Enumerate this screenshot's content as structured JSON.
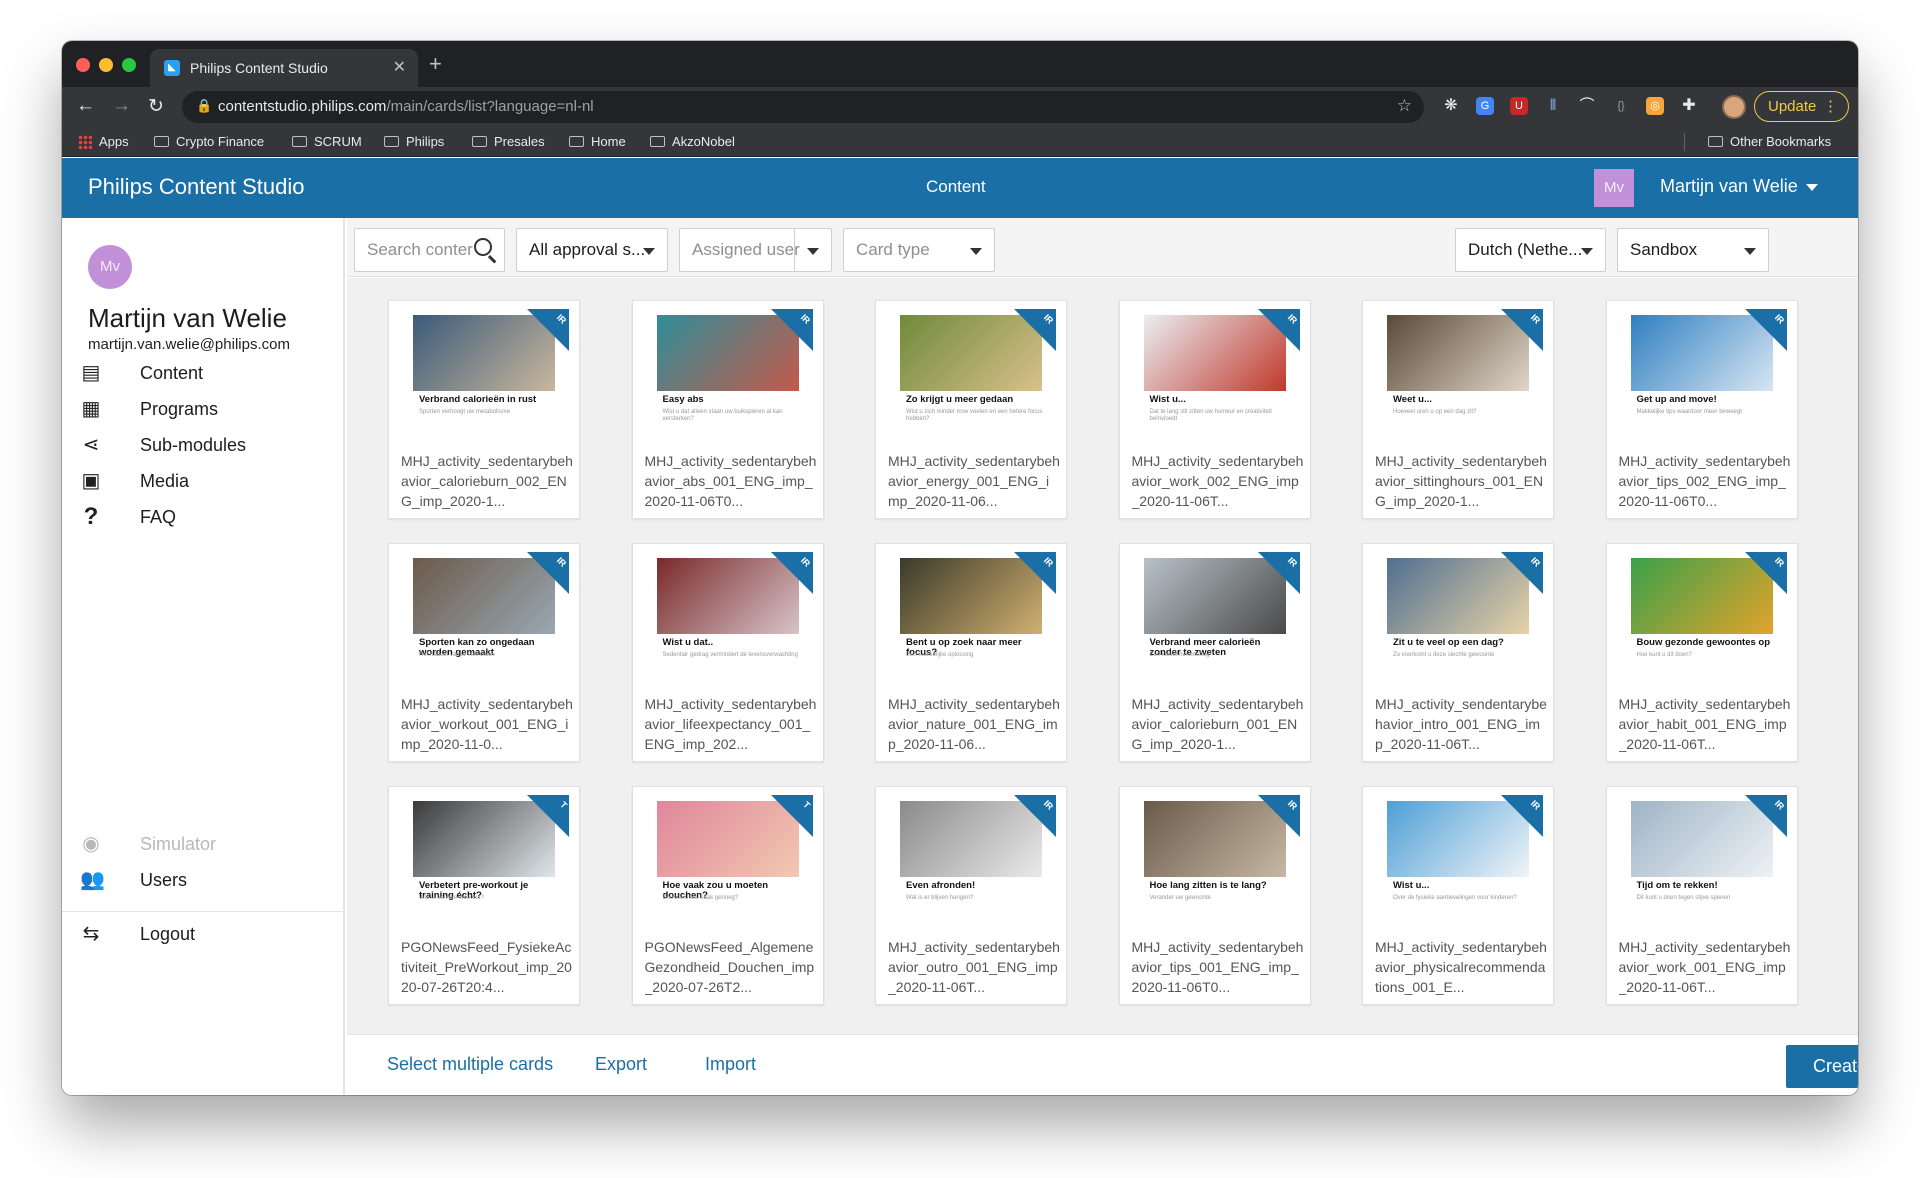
{
  "browser": {
    "tab_title": "Philips Content Studio",
    "url_host": "contentstudio.philips.com",
    "url_path": "/main/cards/list?language=nl-nl",
    "update_label": "Update",
    "bookmarks": [
      "Apps",
      "Crypto Finance",
      "SCRUM",
      "Philips",
      "Presales",
      "Home",
      "AkzoNobel"
    ],
    "other_bookmarks": "Other Bookmarks"
  },
  "header": {
    "app_title": "Philips Content Studio",
    "section": "Content",
    "avatar_initials": "Mv",
    "user_name": "Martijn van Welie"
  },
  "sidebar": {
    "avatar_initials": "Mv",
    "name": "Martijn van Welie",
    "email": "martijn.van.welie@philips.com",
    "items": [
      {
        "label": "Content"
      },
      {
        "label": "Programs"
      },
      {
        "label": "Sub-modules"
      },
      {
        "label": "Media"
      },
      {
        "label": "FAQ"
      }
    ],
    "bottom_items": [
      {
        "label": "Simulator"
      },
      {
        "label": "Users"
      },
      {
        "label": "Logout"
      }
    ]
  },
  "filters": {
    "search_placeholder": "Search conter",
    "approval": "All approval s...",
    "assigned_placeholder": "Assigned user",
    "card_type_placeholder": "Card type",
    "language": "Dutch (Nethe...",
    "environment": "Sandbox"
  },
  "cards": [
    {
      "badge": "IR",
      "title": "Verbrand calorieën in rust",
      "subtitle": "Sporten verhoogt uw metabolisme",
      "name": "MHJ_activity_sedentarybehavior_calorieburn_002_ENG_imp_2020-1..."
    },
    {
      "badge": "IR",
      "title": "Easy abs",
      "subtitle": "Wist u dat alleen staan uw buikspieren al kan versterken?",
      "name": "MHJ_activity_sedentarybehavior_abs_001_ENG_imp_2020-11-06T0..."
    },
    {
      "badge": "IR",
      "title": "Zo krijgt u meer gedaan",
      "subtitle": "Wist u zich minder moe voelen en een betere focus hebben?",
      "name": "MHJ_activity_sedentarybehavior_energy_001_ENG_imp_2020-11-06..."
    },
    {
      "badge": "IR",
      "title": "Wist u...",
      "subtitle": "Dat te lang stil zitten uw humeur en creativiteit beïnvloedt",
      "name": "MHJ_activity_sedentarybehavior_work_002_ENG_imp_2020-11-06T..."
    },
    {
      "badge": "IR",
      "title": "Weet u...",
      "subtitle": "Hoeveel uren u op een dag zit?",
      "name": "MHJ_activity_sedentarybehavior_sittinghours_001_ENG_imp_2020-1..."
    },
    {
      "badge": "IR",
      "title": "Get up and move!",
      "subtitle": "Makkelijke tips waardoor meer beweegt",
      "name": "MHJ_activity_sedentarybehavior_tips_002_ENG_imp_2020-11-06T0..."
    },
    {
      "badge": "IR",
      "title": "Sporten kan zo ongedaan worden gemaakt",
      "subtitle": "Het nadeel van te veel zitten",
      "name": "MHJ_activity_sedentarybehavior_workout_001_ENG_imp_2020-11-0..."
    },
    {
      "badge": "IR",
      "title": "Wist u dat..",
      "subtitle": "Sedentair gedrag vermindert de levensverwachting",
      "name": "MHJ_activity_sedentarybehavior_lifeexpectancy_001_ENG_imp_202..."
    },
    {
      "badge": "IR",
      "title": "Bent u op zoek naar meer focus?",
      "subtitle": "Een makkelijke oplossing",
      "name": "MHJ_activity_sedentarybehavior_nature_001_ENG_imp_2020-11-06..."
    },
    {
      "badge": "IR",
      "title": "Verbrand meer calorieën zonder te zweten",
      "subtitle": "Een kleine herinnering",
      "name": "MHJ_activity_sedentarybehavior_calorieburn_001_ENG_imp_2020-1..."
    },
    {
      "badge": "IR",
      "title": "Zit u te veel op een dag?",
      "subtitle": "Zo voorkomt u deze slechte gewoonte",
      "name": "MHJ_activity_sendentarybehavior_intro_001_ENG_imp_2020-11-06T..."
    },
    {
      "badge": "IR",
      "title": "Bouw gezonde gewoontes op",
      "subtitle": "Hoe kunt u dit doen?",
      "name": "MHJ_activity_sedentarybehavior_habit_001_ENG_imp_2020-11-06T..."
    },
    {
      "badge": "T",
      "title": "Verbetert pre-workout je training écht?",
      "subtitle": "Wat is een pre-workout?",
      "name": "PGONewsFeed_FysiekeActiviteit_PreWorkout_imp_2020-07-26T20:4..."
    },
    {
      "badge": "T",
      "title": "Hoe vaak zou u moeten douchen?",
      "subtitle": "Douche u wel vaak genoeg?",
      "name": "PGONewsFeed_AlgemeneGezondheid_Douchen_imp_2020-07-26T2..."
    },
    {
      "badge": "IR",
      "title": "Even afronden!",
      "subtitle": "Wat is er blijven hangen?",
      "name": "MHJ_activity_sedentarybehavior_outro_001_ENG_imp_2020-11-06T..."
    },
    {
      "badge": "IR",
      "title": "Hoe lang zitten is te lang?",
      "subtitle": "Verander uw gewoonte",
      "name": "MHJ_activity_sedentarybehavior_tips_001_ENG_imp_2020-11-06T0..."
    },
    {
      "badge": "IR",
      "title": "Wist u...",
      "subtitle": "Over de fysieke aanbevelingen voor kinderen?",
      "name": "MHJ_activity_sedentarybehavior_physicalrecommendations_001_E..."
    },
    {
      "badge": "IR",
      "title": "Tijd om te rekken!",
      "subtitle": "Dit kunt u doen tegen stijve spieren",
      "name": "MHJ_activity_sedentarybehavior_work_001_ENG_imp_2020-11-06T..."
    }
  ],
  "actions": {
    "select_multiple": "Select multiple cards",
    "export": "Export",
    "import": "Import",
    "create": "Create"
  },
  "colors": {
    "brand_blue": "#1a6fa6",
    "avatar_purple": "#c190d8"
  }
}
